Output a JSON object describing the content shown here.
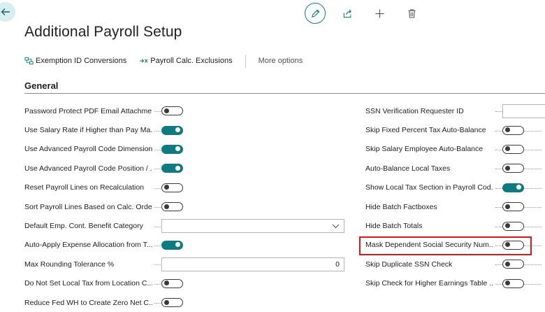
{
  "page": {
    "title": "Additional Payroll Setup"
  },
  "top_actions": {
    "back": "back-arrow-icon",
    "edit": "pencil-icon",
    "share": "share-icon",
    "new": "plus-icon",
    "delete": "trash-icon"
  },
  "action_bar": {
    "items": [
      {
        "label": "Exemption ID Conversions",
        "icon": "conversion-icon"
      },
      {
        "label": "Payroll Calc. Exclusions",
        "icon": "exclusion-icon"
      }
    ],
    "more": "More options"
  },
  "section": {
    "title": "General"
  },
  "left_fields": [
    {
      "label": "Password Protect PDF Email Attachme...",
      "type": "toggle",
      "value": false
    },
    {
      "label": "Use Salary Rate if Higher than Pay Ma...",
      "type": "toggle",
      "value": true
    },
    {
      "label": "Use Advanced Payroll Code Dimensions",
      "type": "toggle",
      "value": true
    },
    {
      "label": "Use Advanced Payroll Code Position / ...",
      "type": "toggle",
      "value": true
    },
    {
      "label": "Reset Payroll Lines on Recalculation",
      "type": "toggle",
      "value": false
    },
    {
      "label": "Sort Payroll Lines Based on Calc. Order",
      "type": "toggle",
      "value": false
    },
    {
      "label": "Default Emp. Cont. Benefit Category",
      "type": "select",
      "value": ""
    },
    {
      "label": "Auto-Apply Expense Allocation from T...",
      "type": "toggle",
      "value": true
    },
    {
      "label": "Max Rounding Tolerance %",
      "type": "number",
      "value": "0"
    },
    {
      "label": "Do Not Set Local Tax from Location C...",
      "type": "toggle",
      "value": false
    },
    {
      "label": "Reduce Fed WH to Create Zero Net C...",
      "type": "toggle",
      "value": false
    }
  ],
  "right_fields": [
    {
      "label": "SSN Verification Requester ID",
      "type": "text",
      "value": ""
    },
    {
      "label": "Skip Fixed Percent Tax Auto-Balance",
      "type": "toggle",
      "value": false
    },
    {
      "label": "Skip Salary Employee Auto-Balance",
      "type": "toggle",
      "value": false
    },
    {
      "label": "Auto-Balance Local Taxes",
      "type": "toggle",
      "value": false
    },
    {
      "label": "Show Local Tax Section in Payroll Cod...",
      "type": "toggle",
      "value": true
    },
    {
      "label": "Hide Batch Factboxes",
      "type": "toggle",
      "value": false
    },
    {
      "label": "Hide Batch Totals",
      "type": "toggle",
      "value": false
    },
    {
      "label": "Mask Dependent Social Security Num...",
      "type": "toggle",
      "value": false,
      "highlighted": true
    },
    {
      "label": "Skip Duplicate SSN Check",
      "type": "toggle",
      "value": false
    },
    {
      "label": "Skip Check for Higher Earnings Table ...",
      "type": "toggle",
      "value": false
    }
  ],
  "colors": {
    "accent": "#0f7b81",
    "highlight": "#d11a1a"
  }
}
